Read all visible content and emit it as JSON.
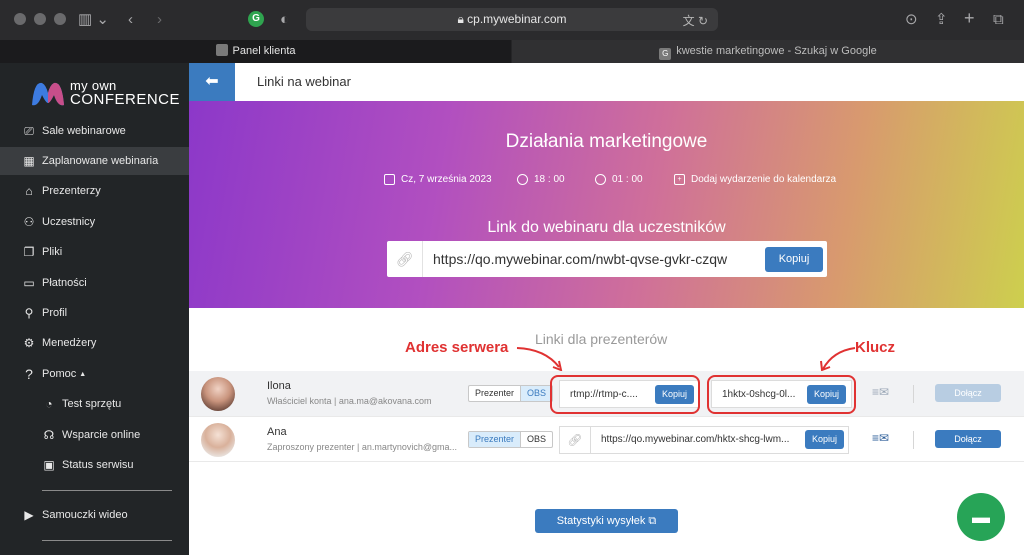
{
  "browser": {
    "url": "cp.mywebinar.com",
    "tabs": [
      {
        "label": "Panel klienta",
        "active": true
      },
      {
        "label": "kwestie marketingowe - Szukaj w Google",
        "active": false,
        "favicon": "G"
      }
    ]
  },
  "sidebar": {
    "logo_top": "my own",
    "logo_bottom": "CONFERENCE",
    "items": [
      {
        "label": "Sale webinarowe",
        "icon": "camera-icon"
      },
      {
        "label": "Zaplanowane webinaria",
        "icon": "calendar-icon",
        "active": true
      },
      {
        "label": "Prezenterzy",
        "icon": "presenter-icon"
      },
      {
        "label": "Uczestnicy",
        "icon": "users-icon"
      },
      {
        "label": "Pliki",
        "icon": "files-icon"
      },
      {
        "label": "Płatności",
        "icon": "payments-icon"
      },
      {
        "label": "Profil",
        "icon": "profile-icon"
      },
      {
        "label": "Menedżery",
        "icon": "managers-icon"
      },
      {
        "label": "Pomoc",
        "icon": "help-icon"
      }
    ],
    "sub_items": [
      {
        "label": "Test sprzętu",
        "icon": "gauge-icon"
      },
      {
        "label": "Wsparcie online",
        "icon": "headset-icon"
      },
      {
        "label": "Status serwisu",
        "icon": "monitor-icon"
      }
    ],
    "tutorials": {
      "label": "Samouczki wideo",
      "icon": "video-icon"
    }
  },
  "header": {
    "title": "Linki na webinar"
  },
  "hero": {
    "title": "Działania marketingowe",
    "date": "Cz, 7 września 2023",
    "time": "18 : 00",
    "duration": "01 : 00",
    "add_calendar": "Dodaj wydarzenie do kalendarza",
    "link_title": "Link do webinaru dla uczestników",
    "link": "https://qo.mywebinar.com/nwbt-qvse-gvkr-czqw",
    "copy_label": "Kopiuj"
  },
  "presenters": {
    "title": "Linki dla prezenterów",
    "toggle_presenter": "Prezenter",
    "toggle_obs": "OBS",
    "copy_label": "Kopiuj",
    "join_label": "Dołącz",
    "rows": [
      {
        "name": "Ilona",
        "role": "Właściciel konta | ana.ma@akovana.com",
        "mode": "OBS",
        "server": "rtmp://rtmp-c....",
        "key": "1hktx-0shcg-0l...",
        "join_enabled": false
      },
      {
        "name": "Ana",
        "role": "Zaproszony prezenter | an.martynovich@gma...",
        "mode": "Prezenter",
        "link": "https://qo.mywebinar.com/hktx-shcg-lwm...",
        "join_enabled": true
      }
    ]
  },
  "annotations": {
    "server_label": "Adres serwera",
    "key_label": "Klucz",
    "color": "#e03232"
  },
  "stats_button": "Statystyki wysyłek",
  "colors": {
    "accent": "#3b7bbf",
    "chat": "#27a457"
  }
}
